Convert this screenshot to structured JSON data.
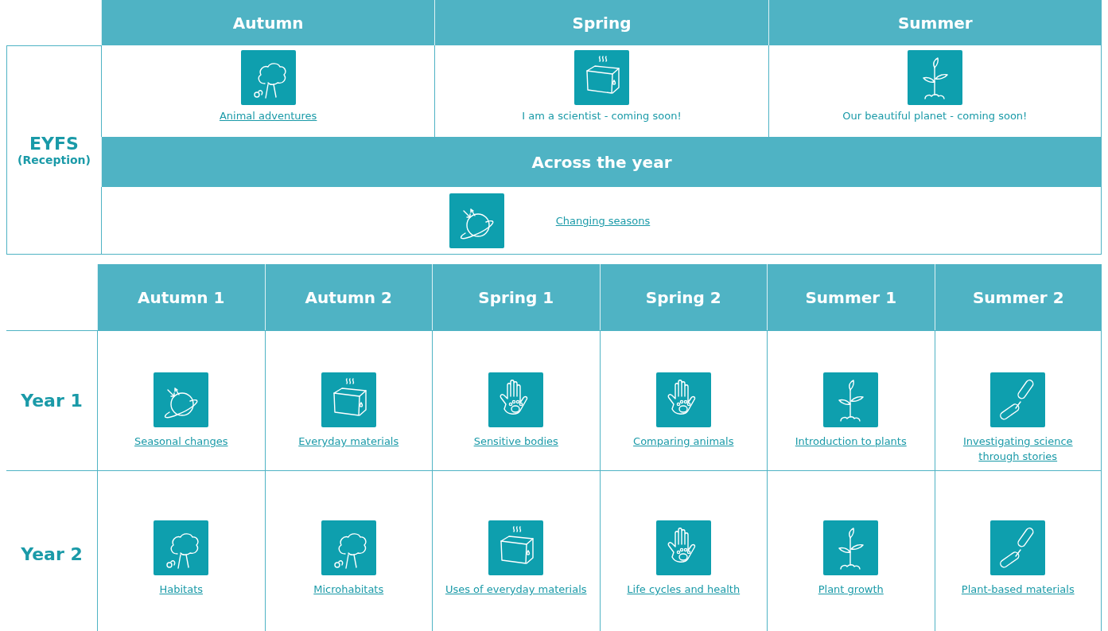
{
  "eyfs": {
    "seasons": [
      "Autumn",
      "Spring",
      "Summer"
    ],
    "label": "EYFS",
    "sublabel": "(Reception)",
    "topics": [
      {
        "kind": "tree",
        "title": "Animal adventures",
        "linked": true
      },
      {
        "kind": "cube",
        "title": "I am a scientist - coming soon!",
        "linked": false
      },
      {
        "kind": "plant",
        "title": "Our beautiful planet - coming soon!",
        "linked": false
      }
    ],
    "across_header": "Across the year",
    "across_topic": {
      "kind": "planet",
      "title": "Changing seasons",
      "linked": true
    }
  },
  "years": {
    "terms": [
      "Autumn 1",
      "Autumn 2",
      "Spring 1",
      "Spring 2",
      "Summer 1",
      "Summer 2"
    ],
    "rows": [
      {
        "label": "Year 1",
        "topics": [
          {
            "kind": "planet",
            "title": "Seasonal changes",
            "linked": true
          },
          {
            "kind": "cube",
            "title": "Everyday materials",
            "linked": true
          },
          {
            "kind": "hand",
            "title": "Sensitive bodies",
            "linked": true
          },
          {
            "kind": "hand",
            "title": "Comparing animals",
            "linked": true
          },
          {
            "kind": "plant",
            "title": "Introduction to plants",
            "linked": true
          },
          {
            "kind": "chain",
            "title": "Investigating science through stories",
            "linked": true
          }
        ]
      },
      {
        "label": "Year 2",
        "topics": [
          {
            "kind": "tree",
            "title": "Habitats",
            "linked": true
          },
          {
            "kind": "tree",
            "title": "Microhabitats",
            "linked": true
          },
          {
            "kind": "cube",
            "title": "Uses of everyday materials",
            "linked": true
          },
          {
            "kind": "hand",
            "title": "Life cycles and health",
            "linked": true
          },
          {
            "kind": "plant",
            "title": "Plant growth",
            "linked": true
          },
          {
            "kind": "chain",
            "title": "Plant-based materials",
            "linked": true
          }
        ]
      }
    ]
  }
}
